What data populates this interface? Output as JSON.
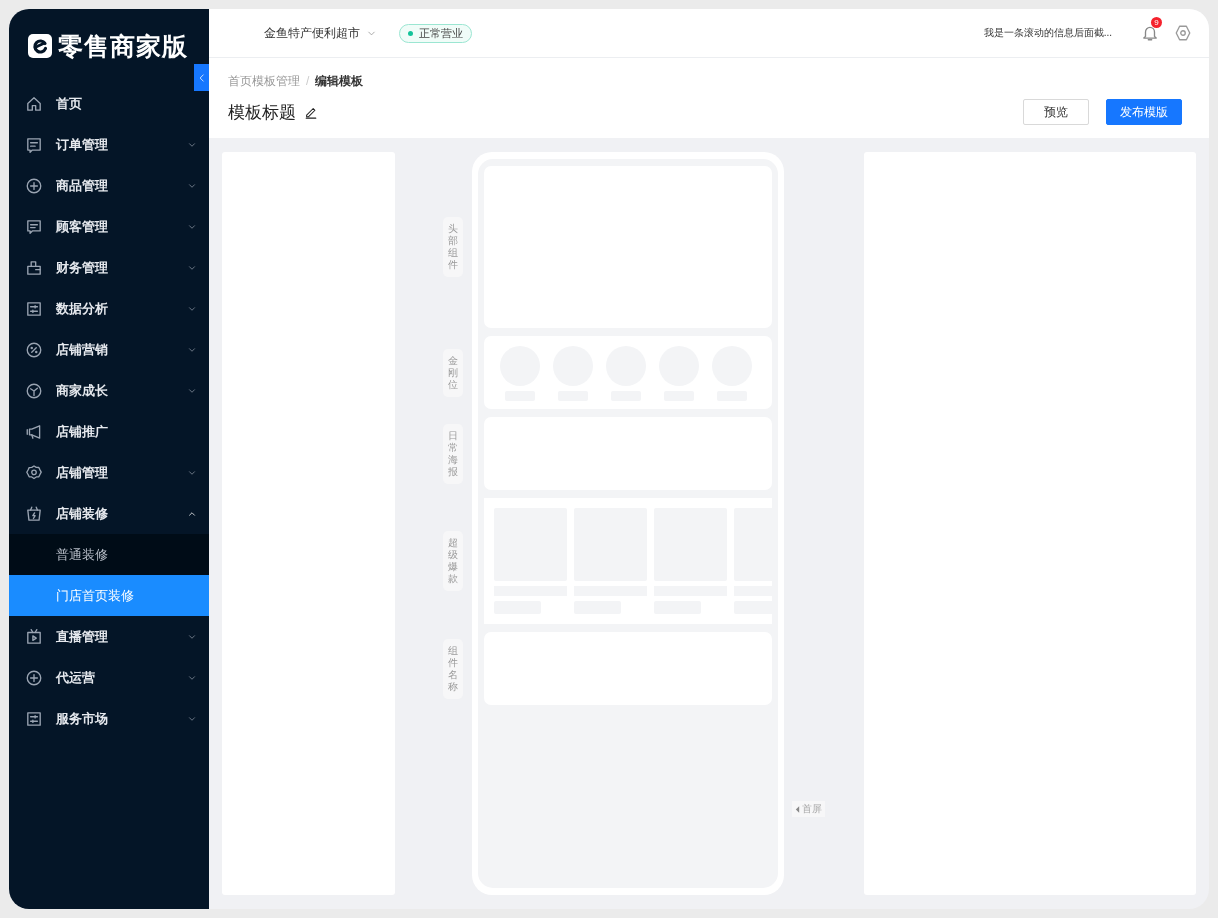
{
  "logo": {
    "text": "零售商家版"
  },
  "sidebar": {
    "items": [
      {
        "kind": "link",
        "label": "首页"
      },
      {
        "kind": "group",
        "label": "订单管理",
        "expanded": false
      },
      {
        "kind": "group",
        "label": "商品管理",
        "expanded": false
      },
      {
        "kind": "group",
        "label": "顾客管理",
        "expanded": false
      },
      {
        "kind": "group",
        "label": "财务管理",
        "expanded": false
      },
      {
        "kind": "group",
        "label": "数据分析",
        "expanded": false
      },
      {
        "kind": "group",
        "label": "店铺营销",
        "expanded": false
      },
      {
        "kind": "group",
        "label": "商家成长",
        "expanded": false
      },
      {
        "kind": "link",
        "label": "店铺推广"
      },
      {
        "kind": "group",
        "label": "店铺管理",
        "expanded": false
      },
      {
        "kind": "group",
        "label": "店铺装修",
        "expanded": true,
        "children": [
          {
            "label": "普通装修",
            "selected": false
          },
          {
            "label": "门店首页装修",
            "selected": true
          }
        ]
      },
      {
        "kind": "group",
        "label": "直播管理",
        "expanded": false
      },
      {
        "kind": "group",
        "label": "代运营",
        "expanded": false
      },
      {
        "kind": "group",
        "label": "服务市场",
        "expanded": false
      }
    ]
  },
  "header": {
    "store": "金鱼特产便利超市",
    "status": "正常营业",
    "marquee": "我是一条滚动的信息后面截...",
    "notification_count": "9"
  },
  "breadcrumb": {
    "items": [
      {
        "label": "首页模板管理",
        "selected": false
      },
      {
        "label": "编辑模板",
        "selected": true
      }
    ],
    "separator": "/"
  },
  "page_title": "模板标题",
  "buttons": [
    {
      "kind": "default",
      "label": "预览"
    },
    {
      "kind": "primary",
      "label": "发布模版"
    }
  ],
  "phone": {
    "sections": [
      {
        "kind": "banner",
        "label": "头部组件"
      },
      {
        "kind": "icons",
        "label": "金刚位"
      },
      {
        "kind": "poster",
        "label": "日常海报"
      },
      {
        "kind": "products",
        "label": "超级爆款"
      },
      {
        "kind": "block",
        "label": "组件名称"
      }
    ],
    "fold_marker": "首屏"
  }
}
